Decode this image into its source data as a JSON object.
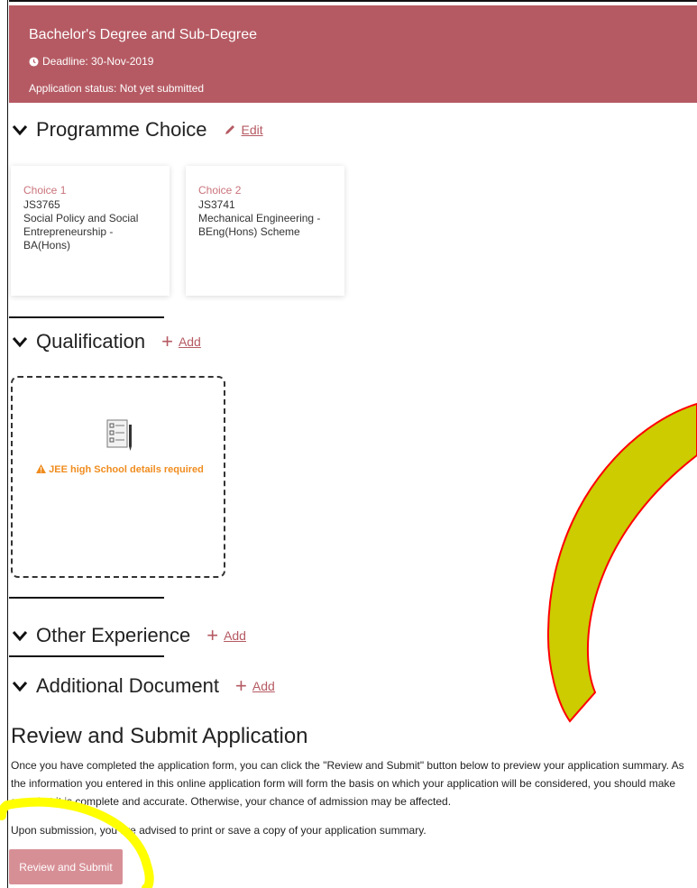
{
  "banner": {
    "title": "Bachelor's Degree and Sub-Degree",
    "deadline": "Deadline: 30-Nov-2019",
    "status": "Application status: Not yet submitted",
    "color": "#b55a63"
  },
  "programme": {
    "heading": "Programme Choice",
    "action": "Edit",
    "choices": [
      {
        "label": "Choice 1",
        "code": "JS3765",
        "name": "Social Policy and Social Entrepreneurship - BA(Hons)"
      },
      {
        "label": "Choice 2",
        "code": "JS3741",
        "name": "Mechanical Engineering - BEng(Hons) Scheme"
      }
    ]
  },
  "qualification": {
    "heading": "Qualification",
    "action": "Add",
    "warning": "JEE high School details required"
  },
  "other_experience": {
    "heading": "Other Experience",
    "action": "Add"
  },
  "additional_document": {
    "heading": "Additional Document",
    "action": "Add"
  },
  "review": {
    "heading": "Review and Submit Application",
    "text": "Once you have completed the application form, you can click the \"Review and Submit\" button below to preview your application summary. As the information you entered in this online application form will form the basis on which your application will be considered, you should make sure that it is complete and accurate. Otherwise, your chance of admission may be affected.",
    "note": "Upon submission, you are advised to print or save a copy of your application summary.",
    "button": "Review and Submit"
  },
  "colors": {
    "accent": "#b55a63",
    "warning": "#f08c1e",
    "annotation_yellow": "#ffff00",
    "arrow_fill": "#cccc00",
    "arrow_stroke": "#ff0000"
  }
}
